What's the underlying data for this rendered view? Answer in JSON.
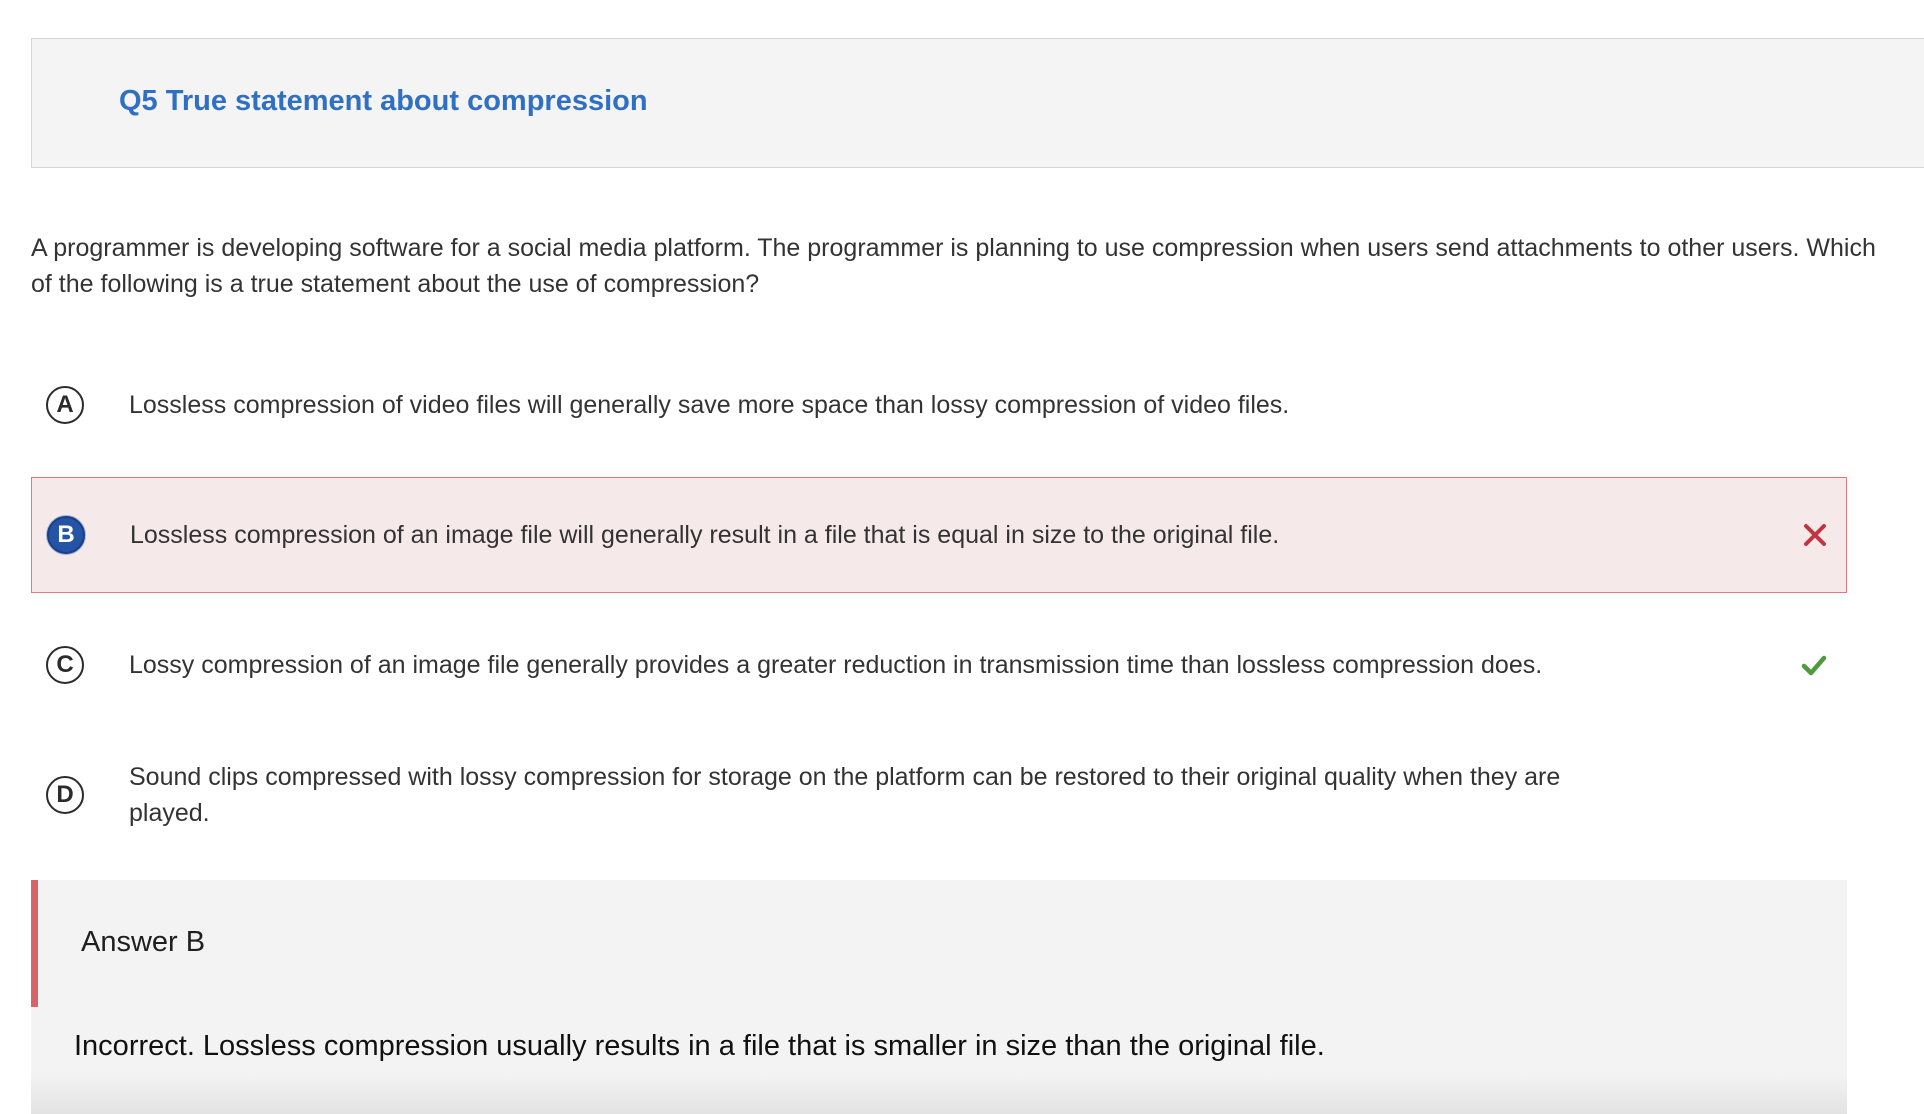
{
  "question": {
    "title": "Q5 True statement about compression",
    "stem": "A programmer is developing software for a social media platform. The programmer is planning to use compression when users send attachments to other users. Which of the following is a true statement about the use of compression?"
  },
  "options": [
    {
      "letter": "A",
      "text": "Lossless compression of video files will generally save more space than lossy compression of video files.",
      "selected": false,
      "status": "none"
    },
    {
      "letter": "B",
      "text": "Lossless compression of an image file will generally result in a file that is equal in size to the original file.",
      "selected": true,
      "status": "incorrect",
      "status_icon": "x-mark-icon"
    },
    {
      "letter": "C",
      "text": "Lossy compression of an image file generally provides a greater reduction in transmission time than lossless compression does.",
      "selected": false,
      "status": "correct",
      "status_icon": "checkmark-icon"
    },
    {
      "letter": "D",
      "text": "Sound clips compressed with lossy compression for storage on the platform can be restored to their original quality when they are played.",
      "selected": false,
      "status": "none"
    }
  ],
  "answer": {
    "label": "Answer B",
    "explanation": "Incorrect. Lossless compression usually results in a file that is smaller in size than the original file."
  },
  "colors": {
    "title": "#2f6fc4",
    "incorrect_bg": "#f6e9ea",
    "incorrect_border": "#e0787f",
    "incorrect_mark": "#c0353f",
    "correct_mark": "#4f9a3f",
    "selected_letter_bg": "#2554a6",
    "answer_bar": "#d9636b"
  }
}
